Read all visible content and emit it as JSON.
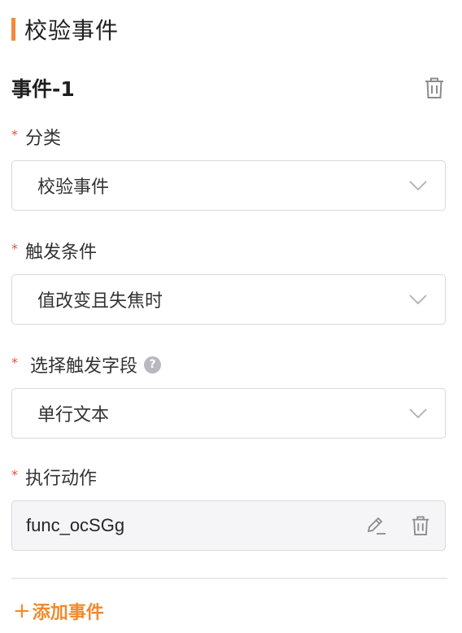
{
  "section": {
    "title": "校验事件"
  },
  "event": {
    "title": "事件-1"
  },
  "fields": {
    "category": {
      "required_mark": "*",
      "label": "分类",
      "value": "校验事件"
    },
    "trigger_condition": {
      "required_mark": "*",
      "label": "触发条件",
      "value": "值改变且失焦时"
    },
    "trigger_field": {
      "required_mark": "*",
      "label": "选择触发字段",
      "help": "?",
      "value": "单行文本"
    },
    "action": {
      "required_mark": "*",
      "label": "执行动作",
      "value": "func_ocSGg"
    }
  },
  "footer": {
    "add_event_plus": "+",
    "add_event_label": "添加事件"
  },
  "colors": {
    "accent": "#f5893a",
    "add_link": "#f08a2d",
    "required": "#e0533a",
    "border": "#d9d9d9",
    "action_bg": "#f5f5f7"
  },
  "icons": {
    "event_delete": "trash-icon",
    "select_arrow": "chevron-down-icon",
    "action_edit": "pencil-icon",
    "action_delete": "trash-icon",
    "help": "question-circle-icon"
  }
}
